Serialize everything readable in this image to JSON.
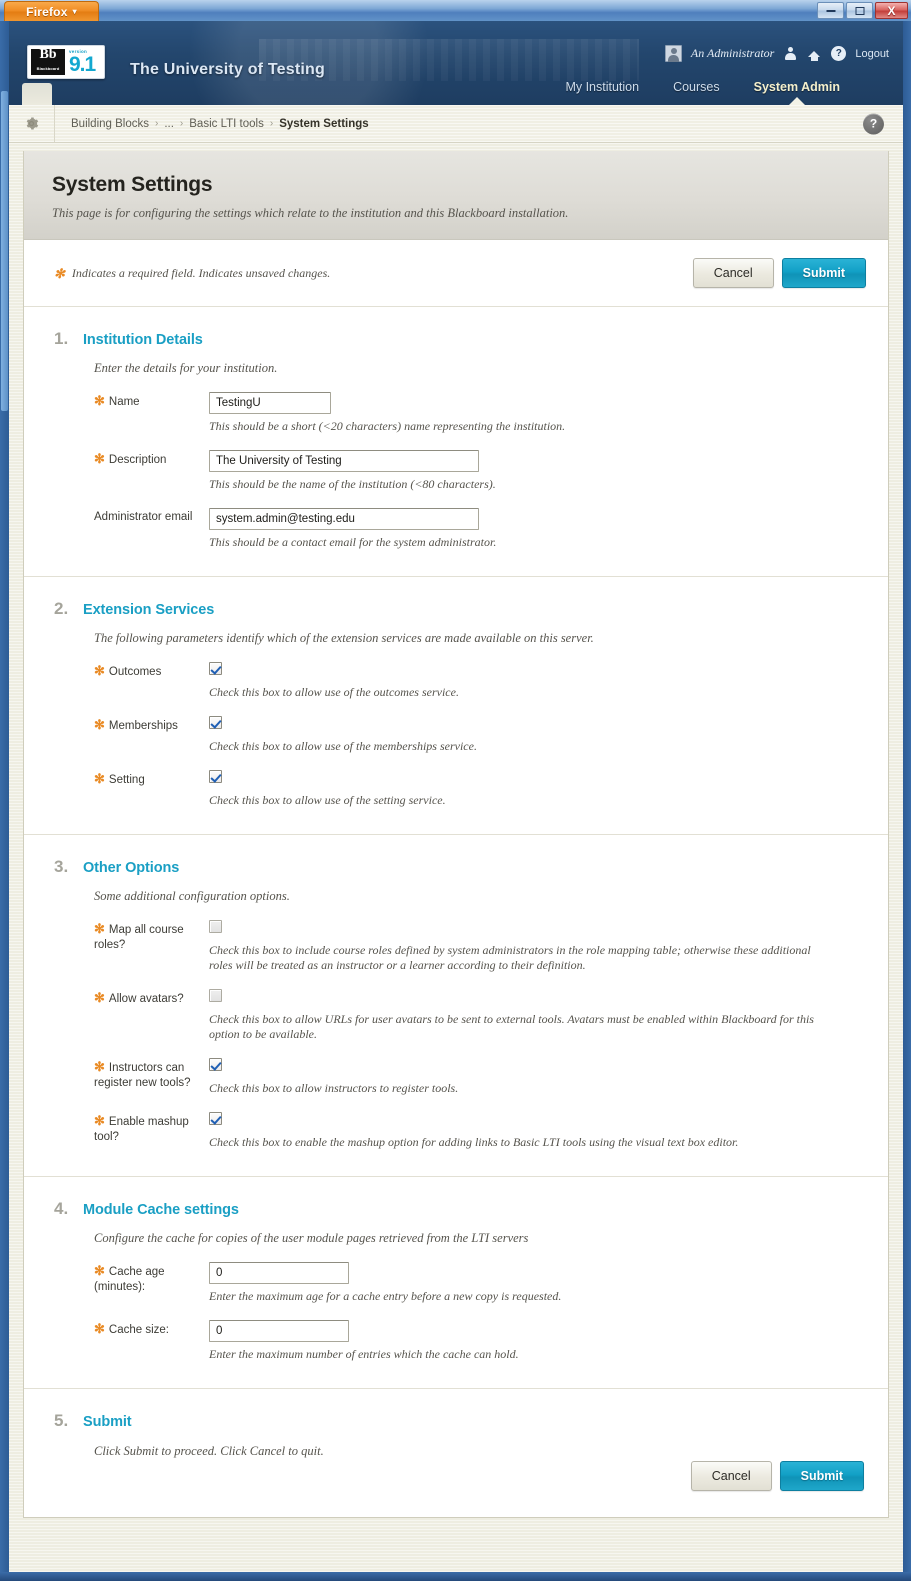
{
  "browser": {
    "menu_button": "Firefox",
    "menu_caret": "▾",
    "window_buttons": {
      "minimize": "–",
      "maximize": "□",
      "close": "X"
    }
  },
  "bb_header": {
    "logo_mark": "Bb",
    "logo_mark_sub": "Blackboard",
    "version_label": "version",
    "version_number": "9.1",
    "institution_title": "The University of Testing",
    "account_name": "An Administrator",
    "logout_label": "Logout",
    "icons": [
      "person-icon",
      "home-icon",
      "help-icon"
    ],
    "tabs": [
      {
        "label": "My Institution",
        "active": false
      },
      {
        "label": "Courses",
        "active": false
      },
      {
        "label": "System Admin",
        "active": true
      }
    ]
  },
  "breadcrumb": {
    "items": [
      {
        "label": "Building Blocks",
        "current": false
      },
      {
        "label": "...",
        "current": false
      },
      {
        "label": "Basic LTI tools",
        "current": false
      },
      {
        "label": "System Settings",
        "current": true
      }
    ],
    "separator": "›",
    "help_label": "?"
  },
  "page": {
    "title": "System Settings",
    "subtitle": "This page is for configuring the settings which relate to the institution and this Blackboard installation.",
    "required_note": "Indicates a required field. Indicates unsaved changes.",
    "required_marker": "✻",
    "cancel_label": "Cancel",
    "submit_label": "Submit"
  },
  "sections": [
    {
      "number": "1.",
      "title": "Institution Details",
      "description": "Enter the details for your institution.",
      "fields": [
        {
          "label": "Name",
          "required": true,
          "type": "text",
          "value": "TestingU",
          "width": "w-small",
          "hint": "This should be a short (<20 characters) name representing the institution."
        },
        {
          "label": "Description",
          "required": true,
          "type": "text",
          "value": "The University of Testing",
          "width": "w-large",
          "hint": "This should be the name of the institution (<80 characters)."
        },
        {
          "label": "Administrator email",
          "required": false,
          "type": "text",
          "value": "system.admin@testing.edu",
          "width": "w-large",
          "hint": "This should be a contact email for the system administrator."
        }
      ]
    },
    {
      "number": "2.",
      "title": "Extension Services",
      "description": "The following parameters identify which of the extension services are made available on this server.",
      "fields": [
        {
          "label": "Outcomes",
          "required": true,
          "type": "checkbox",
          "checked": true,
          "hint": "Check this box to allow use of the outcomes service."
        },
        {
          "label": "Memberships",
          "required": true,
          "type": "checkbox",
          "checked": true,
          "hint": "Check this box to allow use of the memberships service."
        },
        {
          "label": "Setting",
          "required": true,
          "type": "checkbox",
          "checked": true,
          "hint": "Check this box to allow use of the setting service."
        }
      ]
    },
    {
      "number": "3.",
      "title": "Other Options",
      "description": "Some additional configuration options.",
      "fields": [
        {
          "label": "Map all course roles?",
          "required": true,
          "type": "checkbox",
          "checked": false,
          "hint": "Check this box to include course roles defined by system administrators in the role mapping table; otherwise these additional roles will be treated as an instructor or a learner according to their definition."
        },
        {
          "label": "Allow avatars?",
          "required": true,
          "type": "checkbox",
          "checked": false,
          "hint": "Check this box to allow URLs for user avatars to be sent to external tools. Avatars must be enabled within Blackboard for this option to be available."
        },
        {
          "label": "Instructors can register new tools?",
          "required": true,
          "type": "checkbox",
          "checked": true,
          "hint": "Check this box to allow instructors to register tools."
        },
        {
          "label": "Enable mashup tool?",
          "required": true,
          "type": "checkbox",
          "checked": true,
          "hint": "Check this box to enable the mashup option for adding links to Basic LTI tools using the visual text box editor."
        }
      ]
    },
    {
      "number": "4.",
      "title": "Module Cache settings",
      "description": "Configure the cache for copies of the user module pages retrieved from the LTI servers",
      "fields": [
        {
          "label": "Cache age (minutes):",
          "required": true,
          "type": "text",
          "value": "0",
          "width": "w-med",
          "hint": "Enter the maximum age for a cache entry before a new copy is requested."
        },
        {
          "label": "Cache size:",
          "required": true,
          "type": "text",
          "value": "0",
          "width": "w-med",
          "hint": "Enter the maximum number of entries which the cache can hold."
        }
      ]
    }
  ],
  "submit_section": {
    "number": "5.",
    "title": "Submit",
    "description": "Click Submit to proceed. Click Cancel to quit.",
    "cancel_label": "Cancel",
    "submit_label": "Submit"
  },
  "colors": {
    "accent_blue": "#1a9fc4",
    "submit_button": "#12a0c6",
    "required_orange": "#e98a24",
    "header_navy": "#23466d",
    "active_tab_text": "#f4f0cd"
  }
}
